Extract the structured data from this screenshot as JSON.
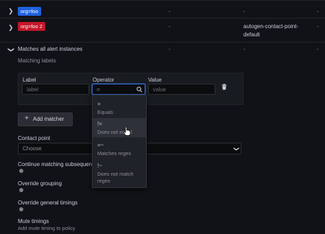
{
  "rows": [
    {
      "tag": "org=foo",
      "tag_color": "#1f62e0",
      "col2": "-",
      "col3": "-",
      "col4": "-"
    },
    {
      "tag": "org=foo 2",
      "tag_color": "#c4162a",
      "col2": "-",
      "col3": "autogen-contact-point-",
      "col3b": "default",
      "col4": "-"
    },
    {
      "label": "Matches all alert instances",
      "col2": "-",
      "col3": "-",
      "col4": "-"
    }
  ],
  "matching_labels_title": "Matching labels",
  "matcher": {
    "label_header": "Label",
    "operator_header": "Operator",
    "value_header": "Value",
    "label_placeholder": "label",
    "operator_placeholder": "=",
    "value_placeholder": "value"
  },
  "operator_options": [
    {
      "symbol": "=",
      "description": "Equals"
    },
    {
      "symbol": "!=",
      "description": "Does not equal"
    },
    {
      "symbol": "=~",
      "description": "Matches regex"
    },
    {
      "symbol": "!~",
      "description": "Does not match",
      "description2": "regex"
    }
  ],
  "add_matcher_label": "Add matcher",
  "contact_point": {
    "label": "Contact point",
    "placeholder": "Choose"
  },
  "continue_matching_label": "Continue matching subsequent sib",
  "override_grouping_label": "Override grouping",
  "override_timings_label": "Override general timings",
  "mute_timings": {
    "label": "Mute timings",
    "hint": "Add mute timing to policy"
  },
  "colors": {
    "accent": "#3d71d9",
    "tag_blue": "#1f62e0",
    "tag_red": "#c4162a"
  }
}
